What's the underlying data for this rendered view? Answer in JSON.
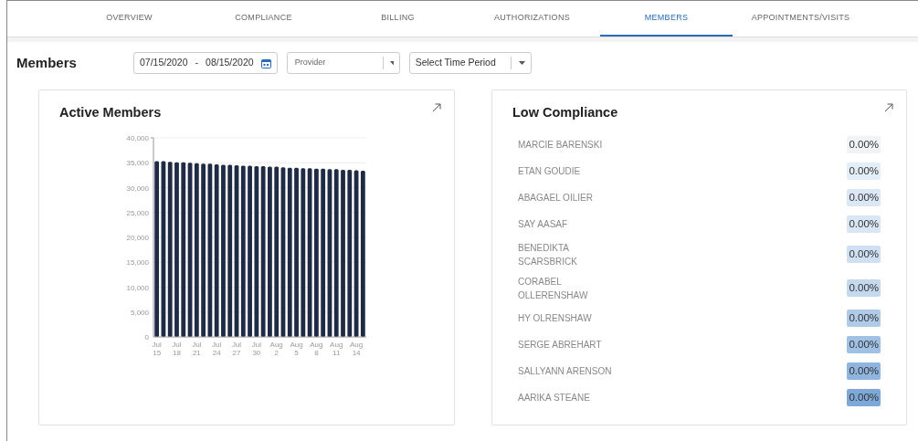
{
  "tabs": [
    {
      "label": "OVERVIEW",
      "selected": false
    },
    {
      "label": "COMPLIANCE",
      "selected": false
    },
    {
      "label": "BILLING",
      "selected": false
    },
    {
      "label": "AUTHORIZATIONS",
      "selected": false
    },
    {
      "label": "MEMBERS",
      "selected": true
    },
    {
      "label": "APPOINTMENTS/VISITS",
      "selected": false
    }
  ],
  "page_title": "Members",
  "filters": {
    "date_from": "07/15/2020",
    "date_separator": "-",
    "date_to": "08/15/2020",
    "provider": {
      "placeholder": "Provider"
    },
    "time_period": {
      "value": "Select Time Period"
    }
  },
  "active_members": {
    "title": "Active Members",
    "chart_data": {
      "type": "bar",
      "categories": [
        "Jul 15",
        null,
        null,
        "Jul 18",
        null,
        null,
        "Jul 21",
        null,
        null,
        "Jul 24",
        null,
        null,
        "Jul 27",
        null,
        null,
        "Jul 30",
        null,
        null,
        "Aug 2",
        null,
        null,
        "Aug 5",
        null,
        null,
        "Aug 8",
        null,
        null,
        "Aug 11",
        null,
        null,
        "Aug 14",
        null
      ],
      "series": [
        {
          "color": "#1f2a44",
          "values": [
            35300,
            35300,
            35200,
            35100,
            35100,
            35000,
            34900,
            34800,
            34800,
            34700,
            34600,
            34600,
            34500,
            34400,
            34400,
            34300,
            34300,
            34200,
            34200,
            34100,
            34000,
            34000,
            33900,
            33900,
            33800,
            33800,
            33700,
            33700,
            33600,
            33600,
            33500,
            33400
          ]
        }
      ],
      "ylim": [
        0,
        40000
      ],
      "grid": true,
      "yticks": [
        {
          "value": 0,
          "label": "0"
        },
        {
          "value": 5000,
          "label": "5,000"
        },
        {
          "value": 10000,
          "label": "10,000"
        },
        {
          "value": 15000,
          "label": "15,000"
        },
        {
          "value": 20000,
          "label": "20,000"
        },
        {
          "value": 25000,
          "label": "25,000"
        },
        {
          "value": 30000,
          "label": "30,000"
        },
        {
          "value": 35000,
          "label": "35,000"
        },
        {
          "value": 40000,
          "label": "40,000"
        }
      ]
    }
  },
  "low_compliance": {
    "title": "Low Compliance",
    "rows": [
      {
        "name": "MARCIE BARENSKI",
        "value": "0.00%",
        "color": "#f1f3f5"
      },
      {
        "name": "ETAN GOUDIE",
        "value": "0.00%",
        "color": "#e4eef8"
      },
      {
        "name": "ABAGAEL OILIER",
        "value": "0.00%",
        "color": "#dbe7f5"
      },
      {
        "name": "SAY AASAF",
        "value": "0.00%",
        "color": "#d9e6f4"
      },
      {
        "name": "BENEDIKTA SCARSBRICK",
        "value": "0.00%",
        "color": "#cfe0f2"
      },
      {
        "name": "CORABEL OLLERENSHAW",
        "value": "0.00%",
        "color": "#c4d8ee"
      },
      {
        "name": "HY OLRENSHAW",
        "value": "0.00%",
        "color": "#b0cbe8"
      },
      {
        "name": "SERGE ABREHART",
        "value": "0.00%",
        "color": "#a0c0e4"
      },
      {
        "name": "SALLYANN ARENSON",
        "value": "0.00%",
        "color": "#8fb4de"
      },
      {
        "name": "AARIKA STEANE",
        "value": "0.00%",
        "color": "#7ea8d7"
      }
    ]
  }
}
